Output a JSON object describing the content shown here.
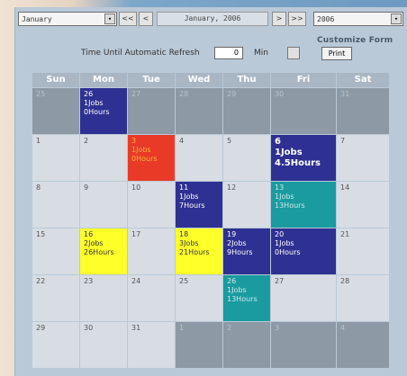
{
  "toolbar": {
    "month_select": "January",
    "prev_year_label": "<<",
    "prev_month_label": "<",
    "current_date": "January, 2006",
    "next_month_label": ">",
    "next_year_label": ">>",
    "year_select": "2006",
    "dropdown_glyph": "▾"
  },
  "customize_form_label": "Customize Form",
  "refresh": {
    "label": "Time Until Automatic Refresh",
    "value": "0",
    "unit": "Min",
    "print_label": "Print"
  },
  "days": [
    "Sun",
    "Mon",
    "Tue",
    "Wed",
    "Thu",
    "Fri",
    "Sat"
  ],
  "weeks": [
    [
      {
        "day": "25",
        "style": "gray",
        "lines": []
      },
      {
        "day": "26",
        "style": "blue",
        "lines": [
          "1Jobs",
          "0Hours"
        ]
      },
      {
        "day": "27",
        "style": "gray",
        "lines": []
      },
      {
        "day": "28",
        "style": "gray",
        "lines": []
      },
      {
        "day": "29",
        "style": "gray",
        "lines": []
      },
      {
        "day": "30",
        "style": "gray",
        "lines": []
      },
      {
        "day": "31",
        "style": "gray",
        "lines": []
      }
    ],
    [
      {
        "day": "1",
        "style": "light",
        "lines": []
      },
      {
        "day": "2",
        "style": "light",
        "lines": []
      },
      {
        "day": "3",
        "style": "red",
        "lines": [
          "1Jobs",
          "0Hours"
        ]
      },
      {
        "day": "4",
        "style": "light",
        "lines": []
      },
      {
        "day": "5",
        "style": "light",
        "lines": []
      },
      {
        "day": "6",
        "style": "blue big",
        "lines": [
          "1Jobs",
          "4.5Hours"
        ]
      },
      {
        "day": "7",
        "style": "light",
        "lines": []
      }
    ],
    [
      {
        "day": "8",
        "style": "light",
        "lines": []
      },
      {
        "day": "9",
        "style": "light",
        "lines": []
      },
      {
        "day": "10",
        "style": "light",
        "lines": []
      },
      {
        "day": "11",
        "style": "blue",
        "lines": [
          "1Jobs",
          "7Hours"
        ]
      },
      {
        "day": "12",
        "style": "light",
        "lines": []
      },
      {
        "day": "13",
        "style": "teal",
        "lines": [
          "1Jobs",
          "13Hours"
        ]
      },
      {
        "day": "14",
        "style": "light",
        "lines": []
      }
    ],
    [
      {
        "day": "15",
        "style": "light",
        "lines": []
      },
      {
        "day": "16",
        "style": "yellow",
        "lines": [
          "2Jobs",
          "26Hours"
        ]
      },
      {
        "day": "17",
        "style": "light",
        "lines": []
      },
      {
        "day": "18",
        "style": "yellow",
        "lines": [
          "3Jobs",
          "21Hours"
        ]
      },
      {
        "day": "19",
        "style": "blue",
        "lines": [
          "2Jobs",
          "9Hours"
        ]
      },
      {
        "day": "20",
        "style": "blue",
        "lines": [
          "1Jobs",
          "0Hours"
        ]
      },
      {
        "day": "21",
        "style": "light",
        "lines": []
      }
    ],
    [
      {
        "day": "22",
        "style": "light",
        "lines": []
      },
      {
        "day": "23",
        "style": "light",
        "lines": []
      },
      {
        "day": "24",
        "style": "light",
        "lines": []
      },
      {
        "day": "25",
        "style": "light",
        "lines": []
      },
      {
        "day": "26",
        "style": "teal",
        "lines": [
          "1Jobs",
          "13Hours"
        ]
      },
      {
        "day": "27",
        "style": "light",
        "lines": []
      },
      {
        "day": "28",
        "style": "light",
        "lines": []
      }
    ],
    [
      {
        "day": "29",
        "style": "light",
        "lines": []
      },
      {
        "day": "30",
        "style": "light",
        "lines": []
      },
      {
        "day": "31",
        "style": "light",
        "lines": []
      },
      {
        "day": "1",
        "style": "gray",
        "lines": []
      },
      {
        "day": "2",
        "style": "gray",
        "lines": []
      },
      {
        "day": "3",
        "style": "gray",
        "lines": []
      },
      {
        "day": "4",
        "style": "gray",
        "lines": []
      }
    ]
  ],
  "colors": {
    "blue": "#2e3192",
    "red": "#e83a27",
    "yellow": "#ffff2a",
    "teal": "#1a9ba0",
    "other_month": "#8d99a5",
    "current_month": "#d7dde3"
  }
}
